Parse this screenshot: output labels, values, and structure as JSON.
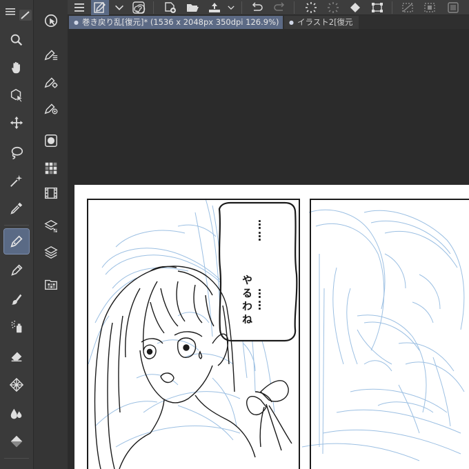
{
  "app": {
    "tool_icons": [
      "menu-icon",
      "zoom-icon",
      "hand-icon",
      "object-select-icon",
      "move-icon",
      "lasso-icon",
      "magic-wand-icon",
      "eyedropper-icon",
      "pen-icon",
      "pencil-icon",
      "brush-icon",
      "airbrush-icon",
      "eraser-icon",
      "blend-icon",
      "fill-icon",
      "gradient-icon"
    ],
    "active_tool": "pen-icon"
  },
  "command_bar": {
    "icons": [
      "menu-icon",
      "pen-layer-icon",
      "chevron-down-icon",
      "swirl-icon",
      "new-file-icon",
      "open-folder-icon",
      "save-icon",
      "undo-icon",
      "redo-icon",
      "loading-icon",
      "transform-icon",
      "fill-icon",
      "crop-icon",
      "deselect-icon",
      "invert-selection-icon"
    ]
  },
  "tabs": [
    {
      "label": "巻き戻り乱[復元]* (1536 x 2048px 350dpi 126.9%)",
      "active": true
    },
    {
      "label": "イラスト2[復元",
      "active": false
    }
  ],
  "canvas": {
    "speech_bubble_text": "……やるわね……",
    "speech_bubble_lines": [
      "……",
      "やるわね",
      "……"
    ],
    "colors": {
      "sketch_blue": "#8ab4de",
      "ink": "#1a1a1a",
      "paper": "#ffffff",
      "workspace": "#2b2b2b"
    }
  }
}
